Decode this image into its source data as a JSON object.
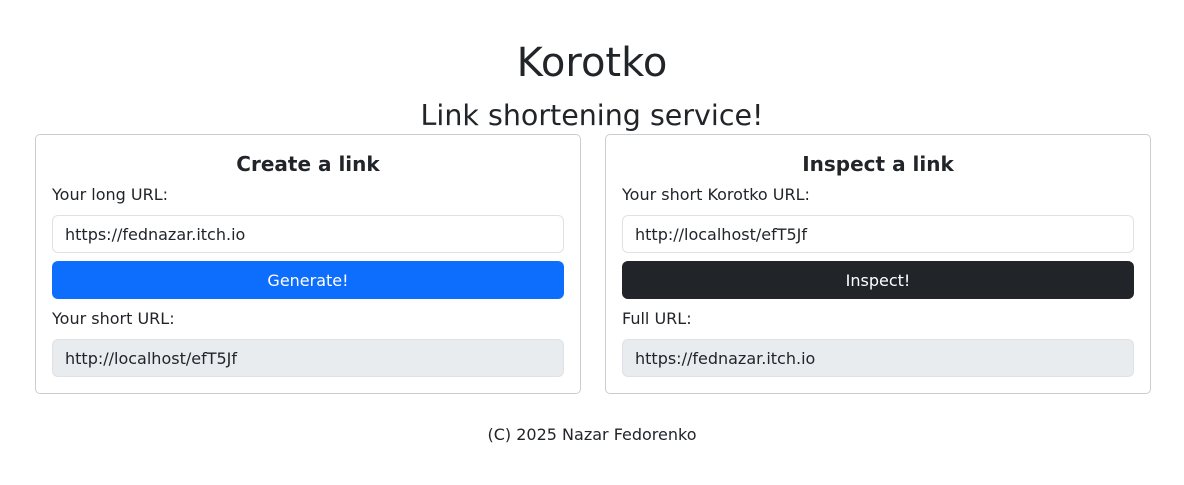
{
  "header": {
    "title": "Korotko",
    "subtitle": "Link shortening service!"
  },
  "create_card": {
    "title": "Create a link",
    "long_url_label": "Your long URL:",
    "long_url_value": "https://fednazar.itch.io",
    "generate_label": "Generate!",
    "short_url_label": "Your short URL:",
    "short_url_value": "http://localhost/efT5Jf"
  },
  "inspect_card": {
    "title": "Inspect a link",
    "short_url_label": "Your short Korotko URL:",
    "short_url_value": "http://localhost/efT5Jf",
    "inspect_label": "Inspect!",
    "full_url_label": "Full URL:",
    "full_url_value": "https://fednazar.itch.io"
  },
  "footer": {
    "text": "(C) 2025 Nazar Fedorenko"
  },
  "colors": {
    "primary_button": "#0d6efd",
    "dark_button": "#212529",
    "readonly_field": "#e9ecef"
  }
}
